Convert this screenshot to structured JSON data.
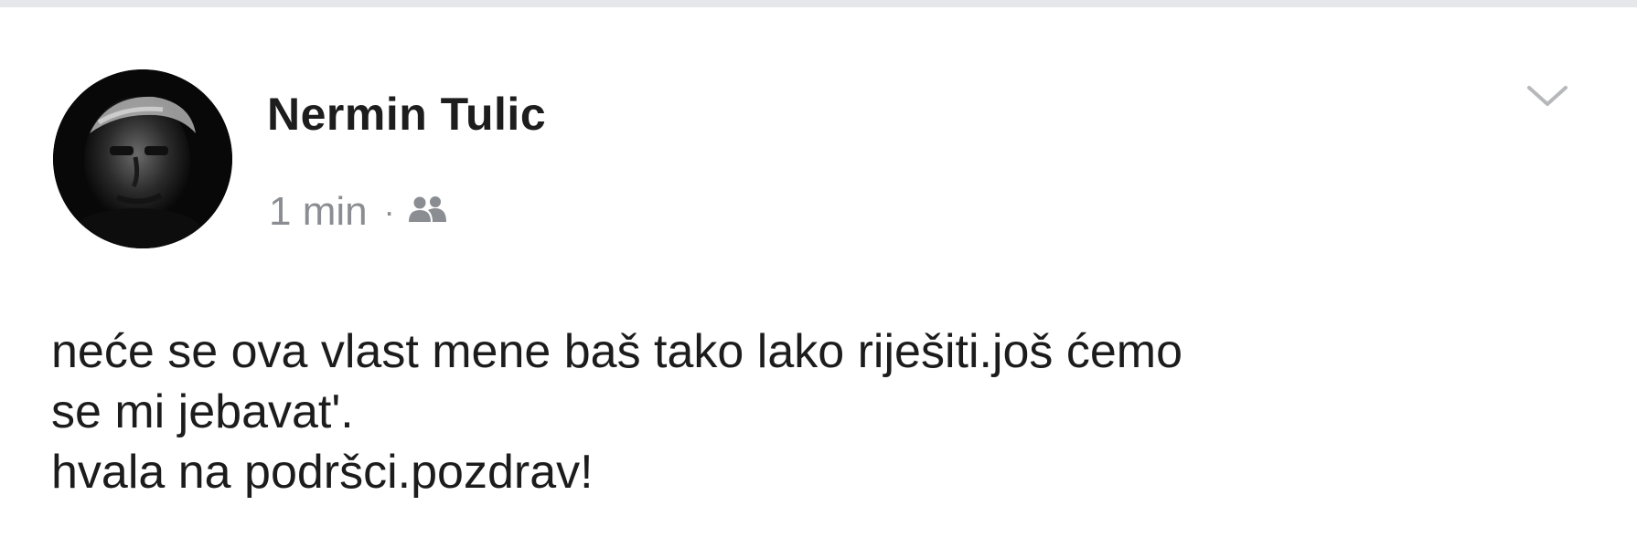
{
  "post": {
    "author": "Nermin Tulic",
    "time": "1 min",
    "separator": "·",
    "audience_icon": "friends-icon",
    "menu_icon": "chevron-down-icon",
    "avatar": "profile-photo",
    "text": "neće se ova vlast mene baš tako lako riješiti.još ćemo\nse mi jebavat'.\nhvala na podršci.pozdrav!"
  }
}
